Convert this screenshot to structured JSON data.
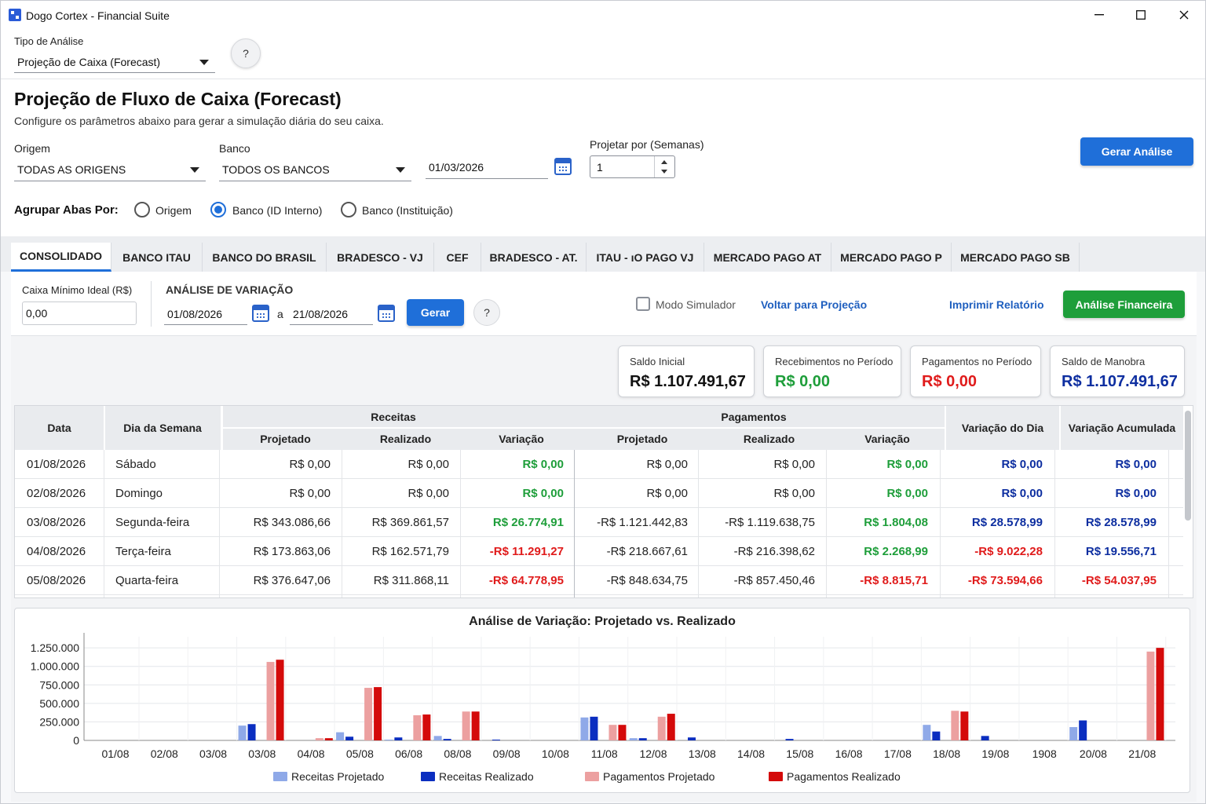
{
  "window": {
    "title": "Dogo Cortex - Financial Suite"
  },
  "top": {
    "tipo_label": "Tipo de Análise",
    "tipo_value": "Projeção de Caixa (Forecast)",
    "help": "?"
  },
  "header": {
    "title": "Projeção de Fluxo de Caixa (Forecast)",
    "subtitle": "Configure os parâmetros abaixo para gerar a simulação diária do seu caixa."
  },
  "filters": {
    "origem_label": "Origem",
    "origem_value": "TODAS AS ORIGENS",
    "banco_label": "Banco",
    "banco_value": "TODOS OS BANCOS",
    "date": "01/03/2026",
    "projetar_label": "Projetar por (Semanas)",
    "projetar_value": "1",
    "gerar_analise": "Gerar Análise"
  },
  "agrupar": {
    "label": "Agrupar Abas Por:",
    "options": [
      "Origem",
      "Banco (ID Interno)",
      "Banco (Instituição)"
    ],
    "selected": "Banco (ID Interno)"
  },
  "tabs": [
    "CONSOLIDADO",
    "BANCO ITAU",
    "BANCO DO BRASIL",
    "BRADESCO - VJ",
    "CEF",
    "BRADESCO - AT.",
    "ITAU - ıO PAGO VJ",
    "MERCADO PAGO AT",
    "MERCADO PAGO P",
    "MERCADO PAGO SB"
  ],
  "controls": {
    "caixa_label": "Caixa Mínimo Ideal (R$)",
    "caixa_value": "0,00",
    "analise_label": "ANÁLISE DE VARIAÇÃO",
    "date_from": "01/08/2026",
    "a": "a",
    "date_to": "21/08/2026",
    "gerar": "Gerar",
    "help": "?",
    "modo_simulador": "Modo Simulador",
    "voltar": "Voltar para Projeção",
    "imprimir": "Imprimir Relatório",
    "analise_fin": "Análise Financeira"
  },
  "cards": [
    {
      "label": "Saldo Inicial",
      "value": "R$ 1.107.491,67",
      "color": "#111111"
    },
    {
      "label": "Recebimentos no Período",
      "value": "R$ 0,00",
      "color": "#1e9e3a"
    },
    {
      "label": "Pagamentos no Período",
      "value": "R$ 0,00",
      "color": "#e01b1b"
    },
    {
      "label": "Saldo de Manobra",
      "value": "R$ 1.107.491,67",
      "color": "#0d2ea0"
    }
  ],
  "table": {
    "headers": {
      "data": "Data",
      "dia": "Dia da Semana",
      "receitas": "Receitas",
      "pagamentos": "Pagamentos",
      "projetado": "Projetado",
      "realizado": "Realizado",
      "variacao": "Variação",
      "var_dia": "Variação do Dia",
      "var_acum": "Variação Acumulada"
    },
    "rows": [
      [
        "01/08/2026",
        "Sábado",
        "R$ 0,00",
        "R$ 0,00",
        "R$ 0,00",
        "R$ 0,00",
        "R$ 0,00",
        "R$ 0,00",
        "R$ 0,00",
        "R$ 0,00"
      ],
      [
        "02/08/2026",
        "Domingo",
        "R$ 0,00",
        "R$ 0,00",
        "R$ 0,00",
        "R$ 0,00",
        "R$ 0,00",
        "R$ 0,00",
        "R$ 0,00",
        "R$ 0,00"
      ],
      [
        "03/08/2026",
        "Segunda-feira",
        "R$ 343.086,66",
        "R$ 369.861,57",
        "R$ 26.774,91",
        "-R$ 1.121.442,83",
        "-R$ 1.119.638,75",
        "R$ 1.804,08",
        "R$ 28.578,99",
        "R$ 28.578,99"
      ],
      [
        "04/08/2026",
        "Terça-feira",
        "R$ 173.863,06",
        "R$ 162.571,79",
        "-R$ 11.291,27",
        "-R$ 218.667,61",
        "-R$ 216.398,62",
        "R$ 2.268,99",
        "-R$ 9.022,28",
        "R$ 19.556,71"
      ],
      [
        "05/08/2026",
        "Quarta-feira",
        "R$ 376.647,06",
        "R$ 311.868,11",
        "-R$ 64.778,95",
        "-R$ 848.634,75",
        "-R$ 857.450,46",
        "-R$ 8.815,71",
        "-R$ 73.594,66",
        "-R$ 54.037,95"
      ]
    ]
  },
  "chart_data": {
    "type": "bar",
    "title": "Análise de Variação: Projetado vs. Realizado",
    "categories": [
      "01/08",
      "02/08",
      "03/08",
      "03/08",
      "04/08",
      "05/08",
      "06/08",
      "08/08",
      "09/08",
      "10/08",
      "11/08",
      "12/08",
      "13/08",
      "14/08",
      "15/08",
      "16/08",
      "17/08",
      "18/08",
      "19/08",
      "1908",
      "20/08",
      "21/08"
    ],
    "yticks": [
      "0",
      "250.000",
      "500.000",
      "750.000",
      "1.000.000",
      "1.250.000"
    ],
    "ylim": [
      0,
      1400000
    ],
    "series": [
      {
        "name": "Receitas Projetado",
        "color": "#8fa9e8",
        "values": [
          0,
          0,
          200000,
          0,
          110000,
          10000,
          60000,
          0,
          0,
          310000,
          30000,
          0,
          0,
          0,
          0,
          0,
          210000,
          0,
          0,
          180000,
          0,
          0
        ]
      },
      {
        "name": "Receitas Realizado",
        "color": "#0b2ec0",
        "values": [
          0,
          0,
          220000,
          0,
          50000,
          40000,
          20000,
          10000,
          0,
          320000,
          30000,
          40000,
          0,
          20000,
          0,
          0,
          120000,
          60000,
          0,
          270000,
          0,
          0
        ]
      },
      {
        "name": "Pagamentos Projetado",
        "color": "#eca0a0",
        "values": [
          0,
          0,
          1060000,
          30000,
          710000,
          340000,
          390000,
          0,
          0,
          210000,
          320000,
          0,
          0,
          0,
          0,
          0,
          400000,
          0,
          0,
          0,
          1200000,
          0
        ]
      },
      {
        "name": "Pagamentos Realizado",
        "color": "#d40a0a",
        "values": [
          0,
          0,
          1090000,
          30000,
          720000,
          350000,
          390000,
          0,
          0,
          210000,
          360000,
          0,
          0,
          0,
          0,
          0,
          390000,
          0,
          0,
          0,
          1250000,
          0
        ]
      }
    ]
  }
}
